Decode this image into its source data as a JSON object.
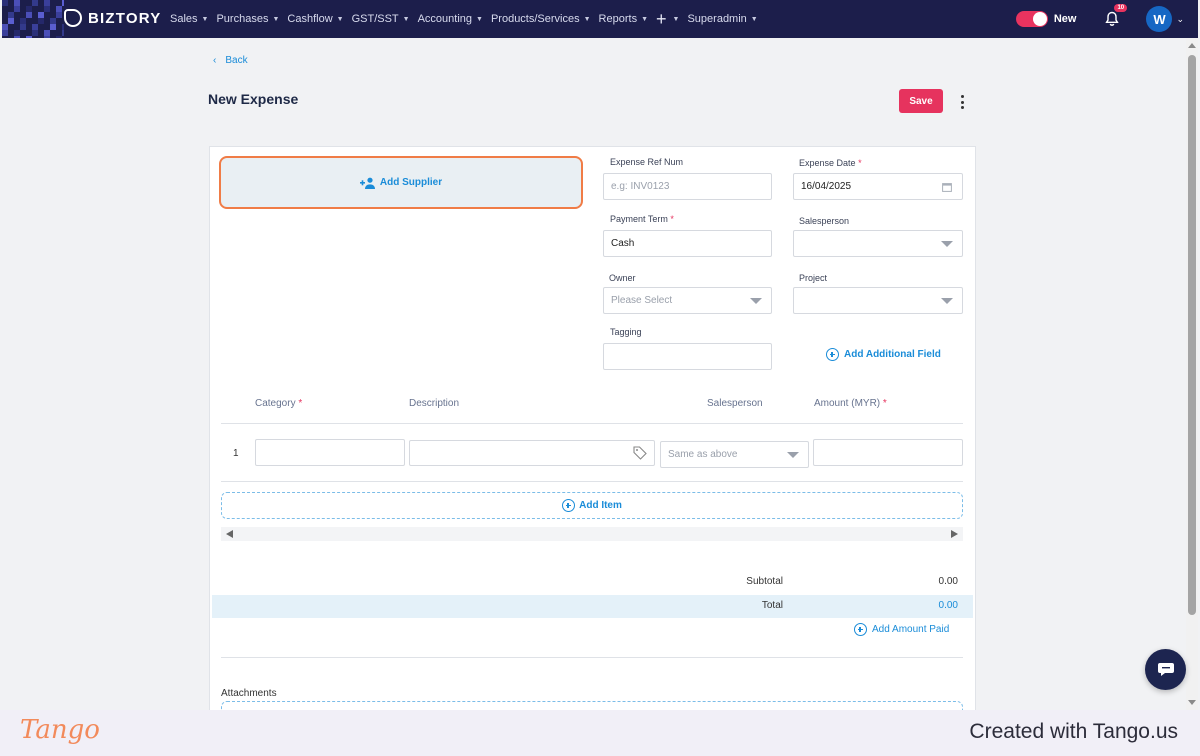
{
  "nav": {
    "brand": "BIZTORY",
    "menu": [
      {
        "label": "Sales",
        "caret": true
      },
      {
        "label": "Purchases",
        "caret": true
      },
      {
        "label": "Cashflow",
        "caret": true
      },
      {
        "label": "GST/SST",
        "caret": true
      },
      {
        "label": "Accounting",
        "caret": true
      },
      {
        "label": "Products/Services",
        "caret": true
      },
      {
        "label": "Reports",
        "caret": true
      },
      {
        "label": "+",
        "caret": true
      },
      {
        "label": "Superadmin",
        "caret": true
      }
    ],
    "toggle_label": "New",
    "notification_count": "10",
    "avatar_initial": "W"
  },
  "header": {
    "back_label": "Back",
    "title": "New Expense",
    "save_label": "Save"
  },
  "form": {
    "add_supplier_label": "Add Supplier",
    "expense_ref_label": "Expense Ref Num",
    "expense_ref_placeholder": "e.g: INV0123",
    "expense_date_label": "Expense Date",
    "expense_date_value": "16/04/2025",
    "payment_term_label": "Payment Term",
    "payment_term_value": "Cash",
    "salesperson_label": "Salesperson",
    "salesperson_value": "",
    "owner_label": "Owner",
    "owner_placeholder": "Please Select",
    "project_label": "Project",
    "project_value": "",
    "tagging_label": "Tagging",
    "tagging_value": "",
    "add_additional_field_label": "Add Additional Field",
    "required_mark": "*"
  },
  "items": {
    "columns": {
      "category": "Category",
      "description": "Description",
      "salesperson": "Salesperson",
      "amount": "Amount (MYR)"
    },
    "rows": [
      {
        "num": "1",
        "category": "",
        "description": "",
        "salesperson_placeholder": "Same as above",
        "amount": ""
      }
    ],
    "add_item_label": "Add Item"
  },
  "summary": {
    "subtotal_label": "Subtotal",
    "subtotal_value": "0.00",
    "total_label": "Total",
    "total_value": "0.00",
    "add_amount_paid_label": "Add Amount Paid"
  },
  "attachments_label": "Attachments",
  "footer": {
    "logo": "Tango",
    "credit": "Created with Tango.us"
  },
  "colors": {
    "nav_bg": "#1c1e4b",
    "accent_red": "#e6335e",
    "link_blue": "#1a8cd8",
    "highlight_orange": "#f07c46"
  }
}
